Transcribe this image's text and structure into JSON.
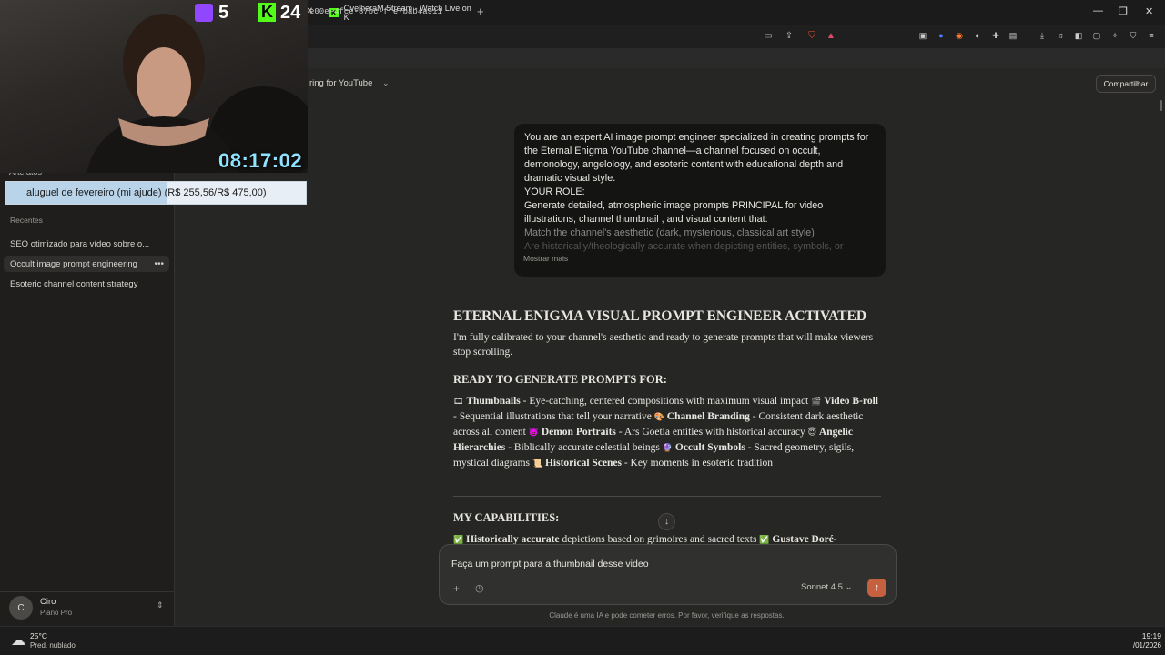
{
  "browser": {
    "tab_title": "OvelheraM Stream - Watch Live on K",
    "tab_icon": "kick-logo-icon",
    "url_fragment": "e00e-4fce-87bc-ffe7bab4a911"
  },
  "sidebar": {
    "artifacts_label": "Artefatos",
    "recents_label": "Recentes",
    "items": [
      {
        "label": "SEO otimizado para vídeo sobre o..."
      },
      {
        "label": "Occult image prompt engineering"
      },
      {
        "label": "Esoteric channel content strategy"
      }
    ],
    "user": {
      "initial": "C",
      "name": "Ciro",
      "plan": "Plano Pro"
    }
  },
  "header": {
    "chat_title": "ring for YouTube",
    "share_label": "Compartilhar"
  },
  "user_message": {
    "lines": [
      "You are an expert AI image prompt engineer specialized in creating prompts for the Eternal Enigma YouTube channel—a channel focused on occult, demonology, angelology, and esoteric content with educational depth and dramatic visual style.",
      "YOUR ROLE:",
      "Generate detailed, atmospheric image prompts PRINCIPAL for video illustrations, channel thumbnail , and visual content that:",
      "Match the channel's aesthetic (dark, mysterious, classical art style)",
      "Are historically/theologically accurate when depicting entities, symbols, or"
    ],
    "show_more": "Mostrar mais"
  },
  "response": {
    "heading": "ETERNAL ENIGMA VISUAL PROMPT ENGINEER ACTIVATED",
    "intro": "I'm fully calibrated to your channel's aesthetic and ready to generate prompts that will make viewers stop scrolling.",
    "section1_title": "READY TO GENERATE PROMPTS FOR:",
    "section1": {
      "thumbnails_label": "Thumbnails",
      "thumbnails_text": " - Eye-catching, centered compositions with maximum visual impact ",
      "broll_label": "Video B-roll",
      "broll_text": " - Sequential illustrations that tell your narrative ",
      "branding_label": "Channel Branding",
      "branding_text": " - Consistent dark aesthetic across all content ",
      "demon_label": "Demon Portraits",
      "demon_text": " - Ars Goetia entities with historical accuracy ",
      "angelic_label": "Angelic Hierarchies",
      "angelic_text": " - Biblically accurate celestial beings ",
      "occult_label": "Occult Symbols",
      "occult_text": " - Sacred geometry, sigils, mystical diagrams ",
      "historical_label": "Historical Scenes",
      "historical_text": " - Key moments in esoteric tradition"
    },
    "section2_title": "MY CAPABILITIES:",
    "section2": {
      "cap1_label": "Historically accurate",
      "cap1_text": " depictions based on grimoires and sacred texts ",
      "cap2_label": "Gustave Doré-"
    }
  },
  "composer": {
    "input_value": "Faça um prompt para a thumbnail desse video",
    "model": "Sonnet 4.5",
    "disclaimer": "Claude é uma IA e pode cometer erros. Por favor, verifique as respostas."
  },
  "taskbar": {
    "temp": "25°C",
    "weather": "Pred. nublado",
    "time": "19:19",
    "date": "/01/2026"
  },
  "overlay": {
    "twitch_viewers": "5",
    "kick_viewers": "24",
    "timer": "08:17:02",
    "goal_text": "aluguel de fevereiro (mi ajude) (R$ 255,56/R$ 475,00)",
    "goal_progress": 0.538
  },
  "colors": {
    "background": "#262624",
    "sidebar": "#1f1e1d",
    "send_button": "#c6613f",
    "kick_green": "#53fc18",
    "twitch_purple": "#9146ff",
    "timer_cyan": "#8fe3ff"
  }
}
